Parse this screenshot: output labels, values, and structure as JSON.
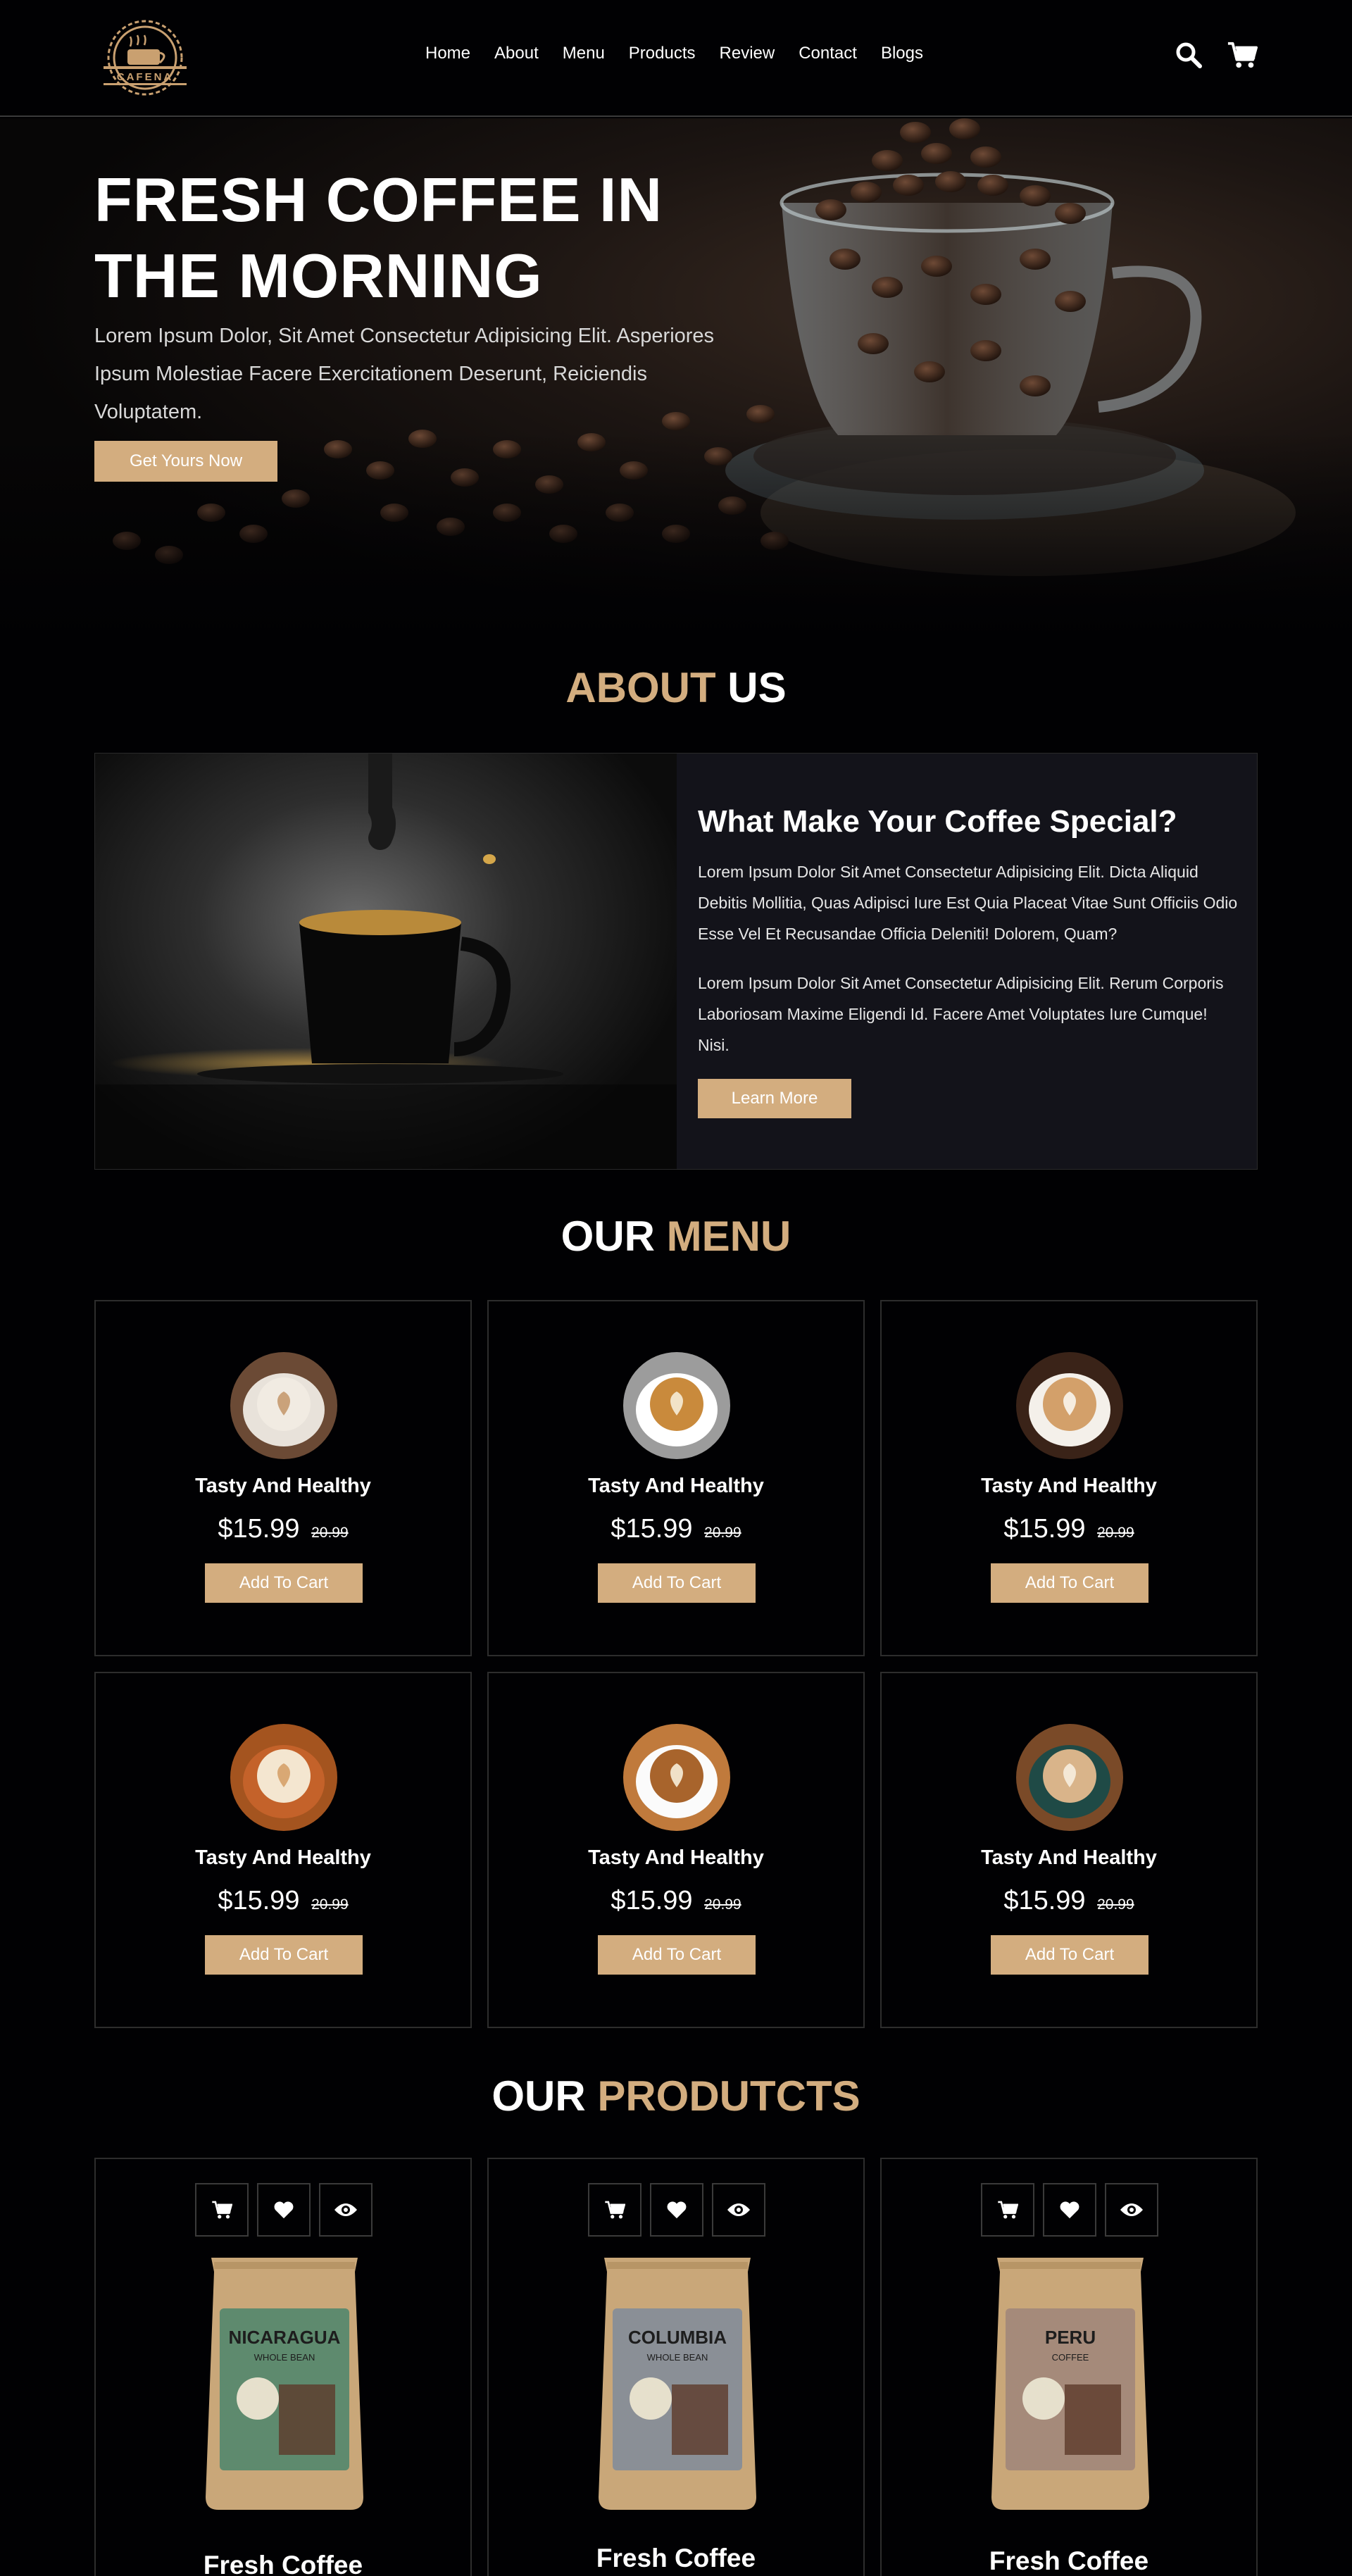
{
  "brand": {
    "logo_text": "CAFENA"
  },
  "nav": [
    "Home",
    "About",
    "Menu",
    "Products",
    "Review",
    "Contact",
    "Blogs"
  ],
  "header_icons": [
    "search-icon",
    "cart-icon"
  ],
  "hero": {
    "title_line1": "FRESH COFFEE IN",
    "title_line2": "THE MORNING",
    "text": "Lorem Ipsum Dolor, Sit Amet Consectetur Adipisicing Elit. Asperiores Ipsum Molestiae Facere Exercitationem Deserunt, Reiciendis Voluptatem.",
    "button": "Get Yours Now"
  },
  "about": {
    "title_accent": "ABOUT",
    "title_rest": " US",
    "heading": "What Make Your Coffee Special?",
    "para1": "Lorem Ipsum Dolor Sit Amet Consectetur Adipisicing Elit. Dicta Aliquid Debitis Mollitia, Quas Adipisci Iure Est Quia Placeat Vitae Sunt Officiis Odio Esse Vel Et Recusandae Officia Deleniti! Dolorem, Quam?",
    "para2": "Lorem Ipsum Dolor Sit Amet Consectetur Adipisicing Elit. Rerum Corporis Laboriosam Maxime Eligendi Id. Facere Amet Voluptates Iure Cumque! Nisi.",
    "button": "Learn More"
  },
  "menu": {
    "title_rest": "OUR ",
    "title_accent": "MENU",
    "items": [
      {
        "name": "Tasty And Healthy",
        "price": "$15.99",
        "old_price": "20.99",
        "button": "Add To Cart"
      },
      {
        "name": "Tasty And Healthy",
        "price": "$15.99",
        "old_price": "20.99",
        "button": "Add To Cart"
      },
      {
        "name": "Tasty And Healthy",
        "price": "$15.99",
        "old_price": "20.99",
        "button": "Add To Cart"
      },
      {
        "name": "Tasty And Healthy",
        "price": "$15.99",
        "old_price": "20.99",
        "button": "Add To Cart"
      },
      {
        "name": "Tasty And Healthy",
        "price": "$15.99",
        "old_price": "20.99",
        "button": "Add To Cart"
      },
      {
        "name": "Tasty And Healthy",
        "price": "$15.99",
        "old_price": "20.99",
        "button": "Add To Cart"
      }
    ]
  },
  "products": {
    "title_rest": "OUR ",
    "title_accent": "PRODUTCTS",
    "items": [
      {
        "name": "Fresh Coffee",
        "bag_label": "NICARAGUA",
        "bag_sub": "WHOLE BEAN",
        "bag_color": "#5e8a6e"
      },
      {
        "name": "Fresh Coffee",
        "bag_label": "COLUMBIA",
        "bag_sub": "WHOLE BEAN",
        "bag_color": "#8a8f96"
      },
      {
        "name": "Fresh Coffee",
        "bag_label": "PERU",
        "bag_sub": "COFFEE",
        "bag_color": "#a58a7a"
      }
    ],
    "icons": [
      "cart-icon",
      "heart-icon",
      "eye-icon"
    ]
  },
  "colors": {
    "accent": "#d3ad7f",
    "background": "#010103",
    "card_border": "#2d2d2d"
  }
}
